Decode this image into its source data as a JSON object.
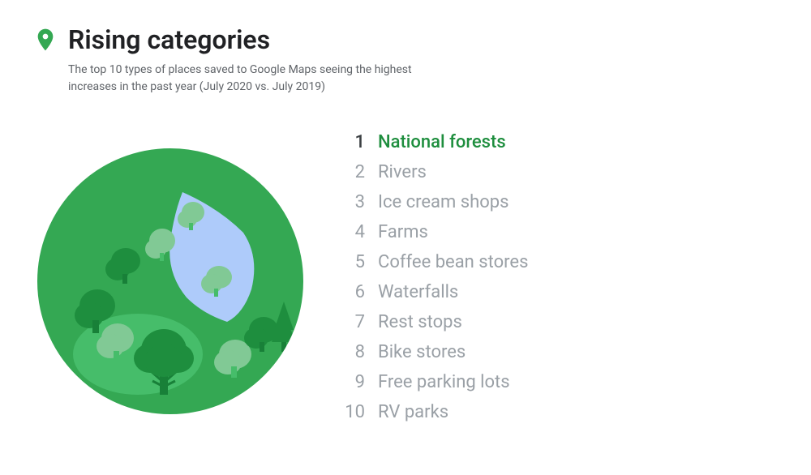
{
  "header": {
    "title": "Rising categories",
    "subtitle": "The top 10 types of places saved to Google Maps seeing the highest increases in the past year (July 2020 vs. July 2019)"
  },
  "rankings": [
    {
      "number": "1",
      "label": "National forests",
      "highlight": true
    },
    {
      "number": "2",
      "label": "Rivers",
      "highlight": false
    },
    {
      "number": "3",
      "label": "Ice cream shops",
      "highlight": false
    },
    {
      "number": "4",
      "label": "Farms",
      "highlight": false
    },
    {
      "number": "5",
      "label": "Coffee bean stores",
      "highlight": false
    },
    {
      "number": "6",
      "label": "Waterfalls",
      "highlight": false
    },
    {
      "number": "7",
      "label": "Rest stops",
      "highlight": false
    },
    {
      "number": "8",
      "label": "Bike stores",
      "highlight": false
    },
    {
      "number": "9",
      "label": "Free parking lots",
      "highlight": false
    },
    {
      "number": "10",
      "label": "RV parks",
      "highlight": false
    }
  ],
  "colors": {
    "green_main": "#34a853",
    "green_dark": "#188038",
    "green_medium": "#1e8e3e",
    "green_light": "#81c995",
    "blue_water": "#aecbfa",
    "pin_color": "#ea4335"
  }
}
